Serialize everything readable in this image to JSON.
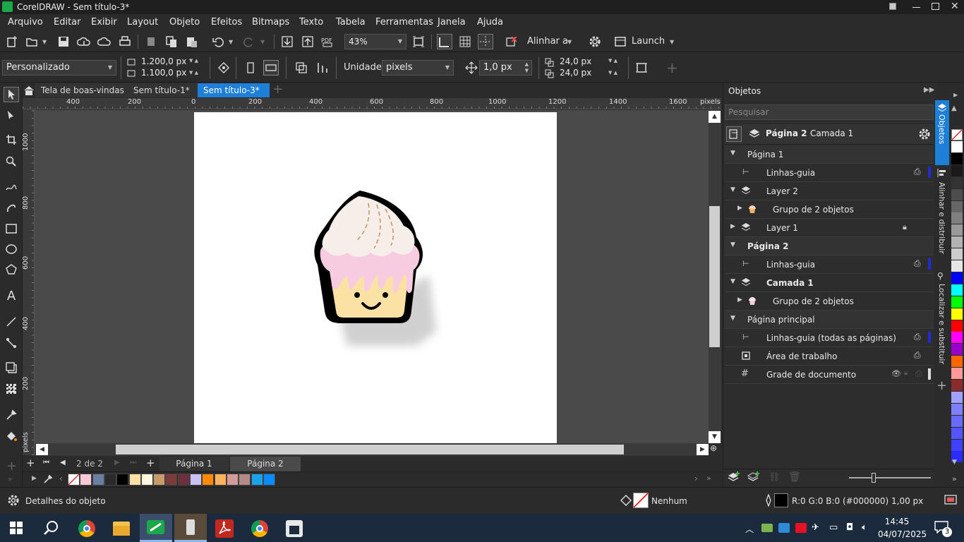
{
  "window": {
    "title": "CorelDRAW - Sem título-3*"
  },
  "menu": [
    "Arquivo",
    "Editar",
    "Exibir",
    "Layout",
    "Objeto",
    "Efeitos",
    "Bitmaps",
    "Texto",
    "Tabela",
    "Ferramentas",
    "Janela",
    "Ajuda"
  ],
  "toolbar": {
    "zoom": "43%",
    "align_label": "Alinhar a",
    "launch_label": "Launch"
  },
  "props": {
    "preset": "Personalizado",
    "width": "1.200,0 px",
    "height": "1.100,0 px",
    "units_label": "Unidades:",
    "units_value": "pixels",
    "nudge": "1,0 px",
    "dup_x": "24,0 px",
    "dup_y": "24,0 px"
  },
  "doc_tabs": [
    "Tela de boas-vindas",
    "Sem título-1*",
    "Sem título-3*"
  ],
  "ruler": {
    "unit": "pixels",
    "h_ticks": [
      "400",
      "200",
      "0",
      "200",
      "400",
      "600",
      "800",
      "1000",
      "1200",
      "1400",
      "1600"
    ],
    "v_ticks": [
      "1000",
      "800",
      "600",
      "400",
      "200"
    ]
  },
  "pages": {
    "counter": "2 de 2",
    "tabs": [
      "Página 1",
      "Página 2"
    ]
  },
  "objects_panel": {
    "title": "Objetos",
    "search_placeholder": "Pesquisar",
    "current_page": "Página 2",
    "current_layer": "Camada 1",
    "rows": [
      "Página 1",
      "Linhas-guia",
      "Layer 2",
      "Grupo de 2 objetos",
      "Layer 1",
      "Página 2",
      "Linhas-guia",
      "Camada 1",
      "Grupo de 2 objetos",
      "Página principal",
      "Linhas-guia (todas as páginas)",
      "Área de trabalho",
      "Grade de documento"
    ]
  },
  "side_tabs": [
    "Objetos",
    "Alinhar e distribuir",
    "Localizar e substituir"
  ],
  "status": {
    "details": "Detalhes do objeto",
    "fill": "Nenhum",
    "outline": "R:0 G:0 B:0 (#000000) 1,00 px"
  },
  "taskbar": {
    "time": "14:45",
    "date": "04/07/2025",
    "notifications": "3"
  },
  "palette_bottom": [
    "#ffffff",
    "#f9c9d6",
    "#6b7fa3",
    "#2a2a2a",
    "#000000",
    "#ffe1a6",
    "#fff6e0",
    "#c99a6b",
    "#7a3b3b",
    "#6e2f3d",
    "#c9c2f2",
    "#ff8a00",
    "#ffb15c",
    "#d49a9a",
    "#b38a8a",
    "#1aa3e8",
    "#0a8cff"
  ],
  "palette_right": [
    "#ffffff",
    "#000000",
    "#1a1a1a",
    "#333333",
    "#4d4d4d",
    "#666666",
    "#808080",
    "#999999",
    "#b3b3b3",
    "#cccccc",
    "#e6e6e6",
    "#0000ff",
    "#00ffff",
    "#00ff00",
    "#ffff00",
    "#ff0000",
    "#ff00ff",
    "#9900cc",
    "#ff6600",
    "#ff9999",
    "#8b2b2b",
    "#a0a0ff",
    "#8080ff",
    "#6a6aff",
    "#5555ff",
    "#4040ff",
    "#2b2bff"
  ]
}
